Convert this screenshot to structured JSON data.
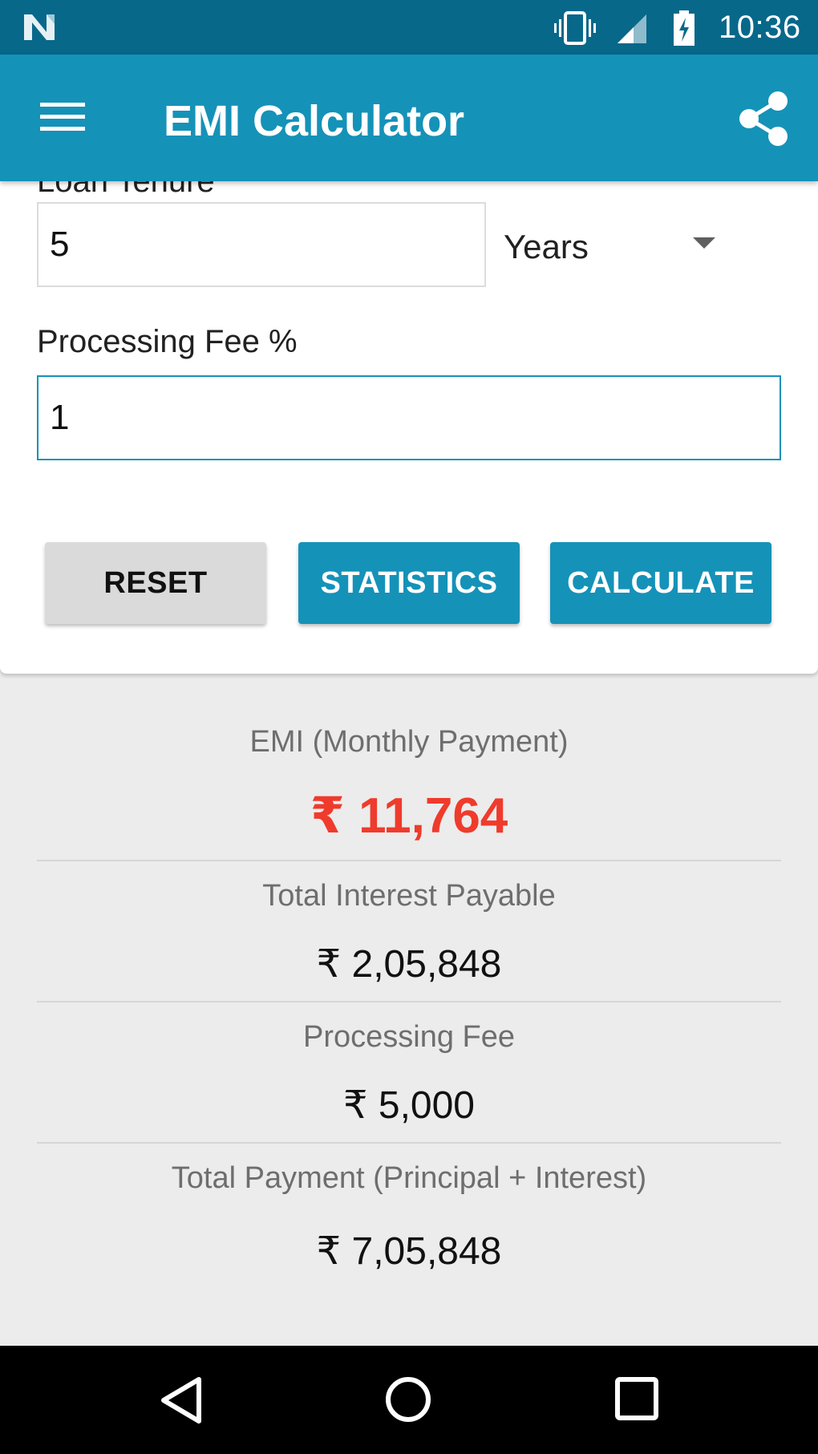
{
  "status_bar": {
    "time": "10:36",
    "icons": [
      "nougat-logo-icon",
      "vibrate-icon",
      "signal-icon",
      "battery-charging-icon"
    ]
  },
  "app_bar": {
    "title": "EMI Calculator",
    "menu_icon": "hamburger-menu-icon",
    "share_icon": "share-icon",
    "color": "#1592b8"
  },
  "form": {
    "tenure_label": "Loan Tenure",
    "tenure_value": "5",
    "tenure_unit": "Years",
    "processing_fee_label": "Processing Fee %",
    "processing_fee_value": "1",
    "buttons": {
      "reset": "RESET",
      "statistics": "STATISTICS",
      "calculate": "CALCULATE"
    }
  },
  "results": {
    "emi_label": "EMI (Monthly Payment)",
    "emi_value": "₹ 11,764",
    "interest_label": "Total Interest Payable",
    "interest_value": "₹ 2,05,848",
    "fee_label": "Processing Fee",
    "fee_value": "₹ 5,000",
    "total_label": "Total Payment (Principal + Interest)",
    "total_value": "₹ 7,05,848",
    "emi_color": "#ef3b2c"
  },
  "nav_bar": {
    "icons": [
      "back-icon",
      "home-icon",
      "recents-icon"
    ]
  }
}
